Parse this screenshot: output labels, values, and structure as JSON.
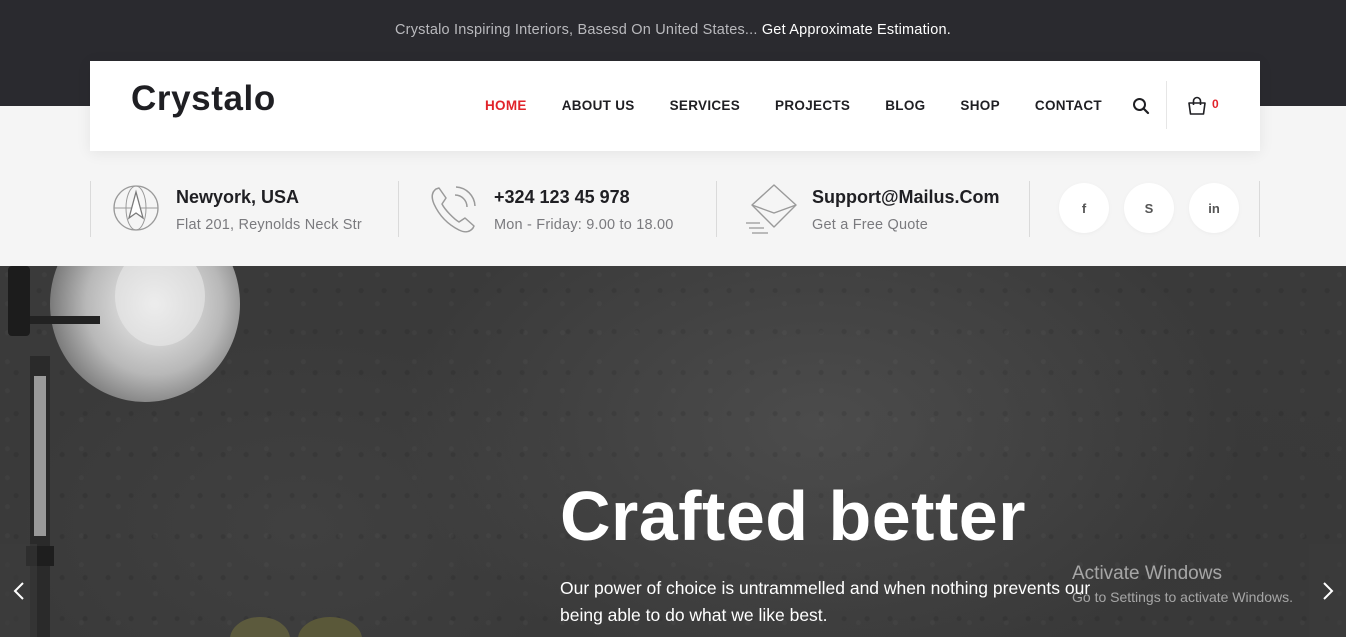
{
  "topbar": {
    "text": "Crystalo Inspiring Interiors, Basesd On United States...",
    "link": "Get Approximate Estimation."
  },
  "header": {
    "logo": "Crystalo",
    "menu": [
      {
        "label": "HOME",
        "active": true
      },
      {
        "label": "ABOUT US",
        "active": false
      },
      {
        "label": "SERVICES",
        "active": false
      },
      {
        "label": "PROJECTS",
        "active": false
      },
      {
        "label": "BLOG",
        "active": false
      },
      {
        "label": "SHOP",
        "active": false
      },
      {
        "label": "CONTACT",
        "active": false
      }
    ],
    "search_icon": "search-icon",
    "cart_icon": "shopping-bag-icon",
    "cart_count": "0"
  },
  "info": {
    "location": {
      "icon": "compass-icon",
      "title": "Newyork, USA",
      "sub": "Flat 201, Reynolds Neck Str"
    },
    "phone": {
      "icon": "phone-icon",
      "title": "+324 123 45 978",
      "sub": "Mon - Friday: 9.00 to 18.00"
    },
    "email": {
      "icon": "envelope-icon",
      "title": "Support@Mailus.Com",
      "sub": "Get a Free Quote"
    }
  },
  "social": [
    {
      "name": "facebook-icon",
      "glyph": "f"
    },
    {
      "name": "skype-icon",
      "glyph": "S"
    },
    {
      "name": "linkedin-icon",
      "glyph": "in"
    }
  ],
  "hero": {
    "title": "Crafted better",
    "subtitle": "Our power of choice is untrammelled and when nothing prevents our being able to do what we like best."
  },
  "activate_windows": {
    "line1": "Activate Windows",
    "line2": "Go to Settings to activate Windows."
  },
  "colors": {
    "accent": "#e1232a",
    "dark": "#2a2a2f",
    "text": "#1f1f23"
  }
}
